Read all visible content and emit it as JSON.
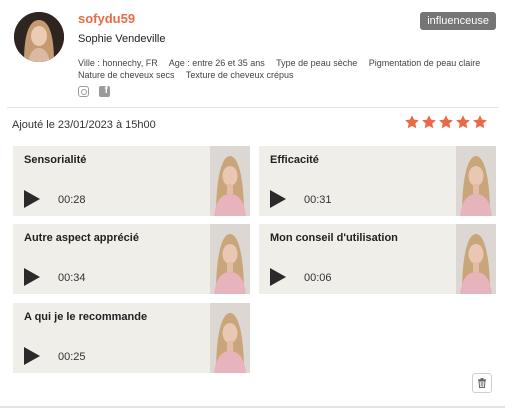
{
  "profile": {
    "username": "sofydu59",
    "full_name": "Sophie Vendeville",
    "badge": "influenceuse",
    "attributes": [
      "Ville : honnechy, FR",
      "Age : entre 26 et 35 ans",
      "Type de peau sèche",
      "Pigmentation de peau claire",
      "Nature de cheveux secs",
      "Texture de cheveux crépus"
    ],
    "social": [
      "instagram-icon",
      "facebook-icon"
    ]
  },
  "review": {
    "added_label": "Ajouté le 23/01/2023 à 15h00",
    "rating": 5,
    "rating_max": 5,
    "star_color": "#ea6a47"
  },
  "videos": [
    {
      "title": "Sensorialité",
      "duration": "00:28"
    },
    {
      "title": "Efficacité",
      "duration": "00:31"
    },
    {
      "title": "Autre aspect apprécié",
      "duration": "00:34"
    },
    {
      "title": "Mon conseil d'utilisation",
      "duration": "00:06"
    },
    {
      "title": "A qui je le recommande",
      "duration": "00:25"
    }
  ],
  "colors": {
    "accent": "#ea6a47",
    "badge_bg": "#757575",
    "tile_bg": "#efeee8"
  }
}
